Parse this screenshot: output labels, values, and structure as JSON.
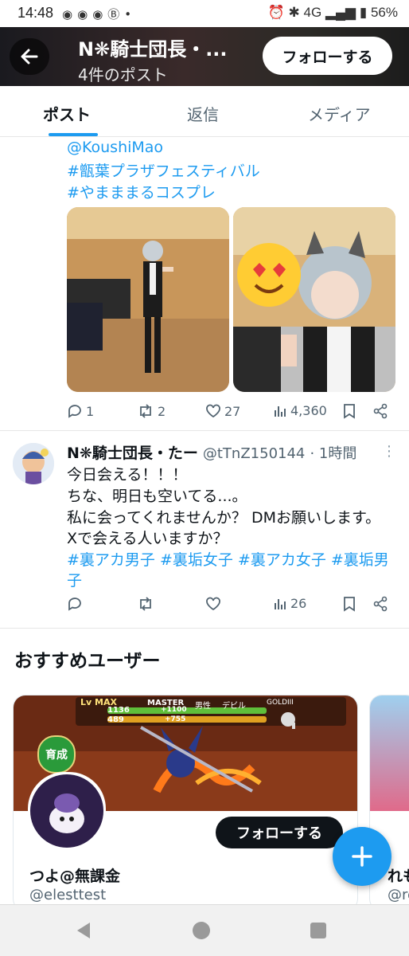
{
  "status_bar": {
    "time": "14:48",
    "network": "4G",
    "battery": "56%",
    "left_icons": [
      "discord-icon",
      "discord-icon",
      "discord-icon",
      "bitcoin-icon",
      "dot-icon"
    ],
    "right_icons": [
      "alarm-icon",
      "bluetooth-icon",
      "signal-icon",
      "battery-icon"
    ]
  },
  "header": {
    "title": "N❋騎士団長・...",
    "subtitle": "4件のポスト",
    "follow_label": "フォローする"
  },
  "tabs": [
    {
      "label": "ポスト",
      "active": true
    },
    {
      "label": "返信",
      "active": false
    },
    {
      "label": "メディア",
      "active": false
    }
  ],
  "post1": {
    "mention": "@KoushiMao",
    "hashtags": [
      "#甑葉プラザフェスティバル",
      "#やまままるコスプレ"
    ],
    "stats": {
      "replies": "1",
      "reposts": "2",
      "likes": "27",
      "views": "4,360"
    }
  },
  "post2": {
    "name": "N❋騎士団長・たー",
    "handle": "@tTnZ150144",
    "time": "· 1時間",
    "lines": [
      "今日会える！！！",
      "ちな、明日も空いてる...。",
      "私に会ってくれませんか？ DMお願いします。",
      "Xで会える人いますか？"
    ],
    "hashtags_line1": "#裏アカ男子 #裏垢女子 #裏アカ女子 #裏垢男",
    "hashtags_line2": "子",
    "stats": {
      "views": "26"
    }
  },
  "recommended": {
    "title": "おすすめユーザー",
    "card": {
      "name": "つよ@無課金",
      "handle": "@elesttest",
      "follow_label": "フォローする",
      "banner_badge": "育成",
      "banner_lv": "Lv MAX",
      "banner_hp": "1136",
      "banner_atk": "489",
      "banner_master": "MASTER",
      "banner_gender": "男性",
      "banner_race": "デビル",
      "banner_gold": "GOLDIII",
      "banner_hp_bonus": "+1100",
      "banner_atk_bonus": "+755"
    },
    "card2": {
      "name_partial": "れも",
      "handle_partial": "@re"
    }
  },
  "colors": {
    "accent": "#1d9bf0",
    "text": "#0f1419",
    "muted": "#536471"
  }
}
